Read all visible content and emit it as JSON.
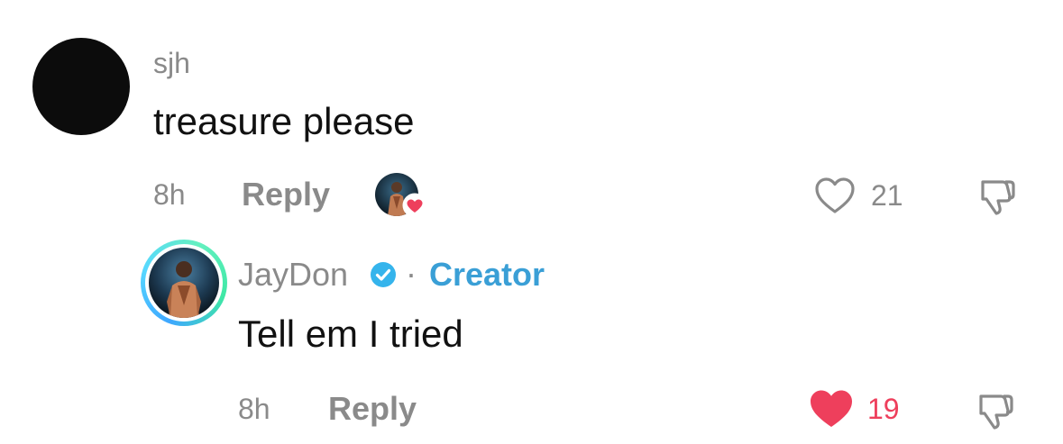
{
  "comment": {
    "username": "sjh",
    "text": "treasure please",
    "time": "8h",
    "reply_label": "Reply",
    "like_count": "21",
    "liked": false
  },
  "reply": {
    "username": "JayDon",
    "separator": "·",
    "badge_label": "Creator",
    "text": "Tell em I tried",
    "time": "8h",
    "reply_label": "Reply",
    "like_count": "19",
    "liked": true
  },
  "icons": {
    "like_outline": "heart-outline-icon",
    "like_filled": "heart-filled-icon",
    "dislike": "thumbs-down-icon",
    "verified": "verified-badge-icon"
  },
  "colors": {
    "meta_gray": "#8a8a8a",
    "creator_blue": "#3a9fd6",
    "like_red": "#ee3f5c",
    "verified_blue": "#35b4ec"
  }
}
